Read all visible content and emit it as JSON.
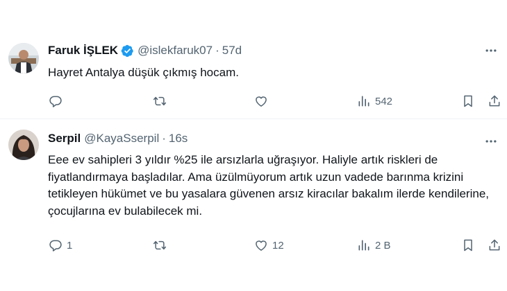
{
  "tweets": [
    {
      "author_name": "Faruk İŞLEK",
      "verified": true,
      "handle": "@islekfaruk07",
      "separator": "·",
      "time": "57d",
      "text": "Hayret Antalya düşük çıkmış hocam.",
      "replies": "",
      "reposts": "",
      "likes": "",
      "views": "542"
    },
    {
      "author_name": "Serpil",
      "verified": false,
      "handle": "@KayaSserpil",
      "separator": "·",
      "time": "16s",
      "text": "Eee ev sahipleri 3 yıldır %25 ile arsızlarla uğraşıyor. Haliyle artık riskleri de fiyatlandırmaya başladılar. Ama üzülmüyorum artık uzun vadede barınma krizini tetikleyen hükümet ve bu yasalara güvenen arsız kiracılar bakalım ilerde kendilerine, çocujlarına ev bulabilecek mi.",
      "replies": "1",
      "reposts": "",
      "likes": "12",
      "views": "2 B"
    }
  ],
  "colors": {
    "verified_blue": "#1d9bf0",
    "secondary_text": "#536471",
    "primary_text": "#0f1419",
    "divider": "#eff3f4"
  },
  "icons": [
    "more-icon",
    "reply-icon",
    "repost-icon",
    "like-icon",
    "views-icon",
    "bookmark-icon",
    "share-icon",
    "verified-badge-icon"
  ]
}
